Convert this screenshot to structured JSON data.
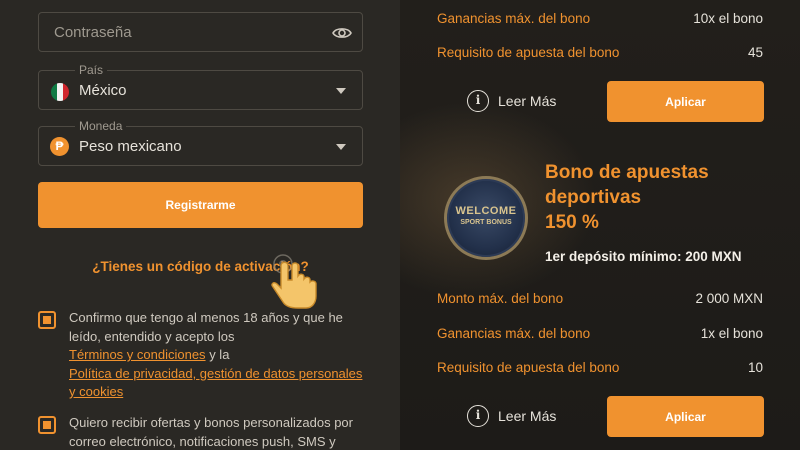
{
  "registration": {
    "password_placeholder": "Contraseña",
    "country": {
      "caption": "País",
      "value": "México"
    },
    "currency": {
      "caption": "Moneda",
      "value": "Peso mexicano",
      "icon_glyph": "₱"
    },
    "register_button": "Registrarme",
    "activation_link": "¿Tienes un código de activación?",
    "consent_age": {
      "text_start": "Confirmo que tengo al menos 18 años y que he leído, entendido y acepto los",
      "terms_link": "Términos y condiciones",
      "connector": "y la",
      "privacy_link": "Política de privacidad, gestión de datos personales y cookies"
    },
    "consent_offers": "Quiero recibir ofertas y bonos personalizados por correo electrónico, notificaciones push, SMS y"
  },
  "bonus_top": {
    "rows": [
      {
        "label": "Ganancias máx. del bono",
        "value": "10x el bono"
      },
      {
        "label": "Requisito de apuesta del bono",
        "value": "45"
      }
    ],
    "read_more": "Leer Más",
    "apply": "Aplicar"
  },
  "sport_bonus": {
    "badge_line1": "WELCOME",
    "badge_line2": "SPORT BONUS",
    "title_line1": "Bono de apuestas",
    "title_line2": "deportivas",
    "title_line3": "150 %",
    "min_deposit": "1er depósito mínimo: 200 MXN",
    "rows": [
      {
        "label": "Monto máx. del bono",
        "value": "2 000 MXN"
      },
      {
        "label": "Ganancias máx. del bono",
        "value": "1x el bono"
      },
      {
        "label": "Requisito de apuesta del bono",
        "value": "10"
      }
    ],
    "read_more": "Leer Más",
    "apply": "Aplicar"
  },
  "colors": {
    "accent": "#f0922f",
    "panel": "#2a2824",
    "background": "#1c1a17"
  }
}
